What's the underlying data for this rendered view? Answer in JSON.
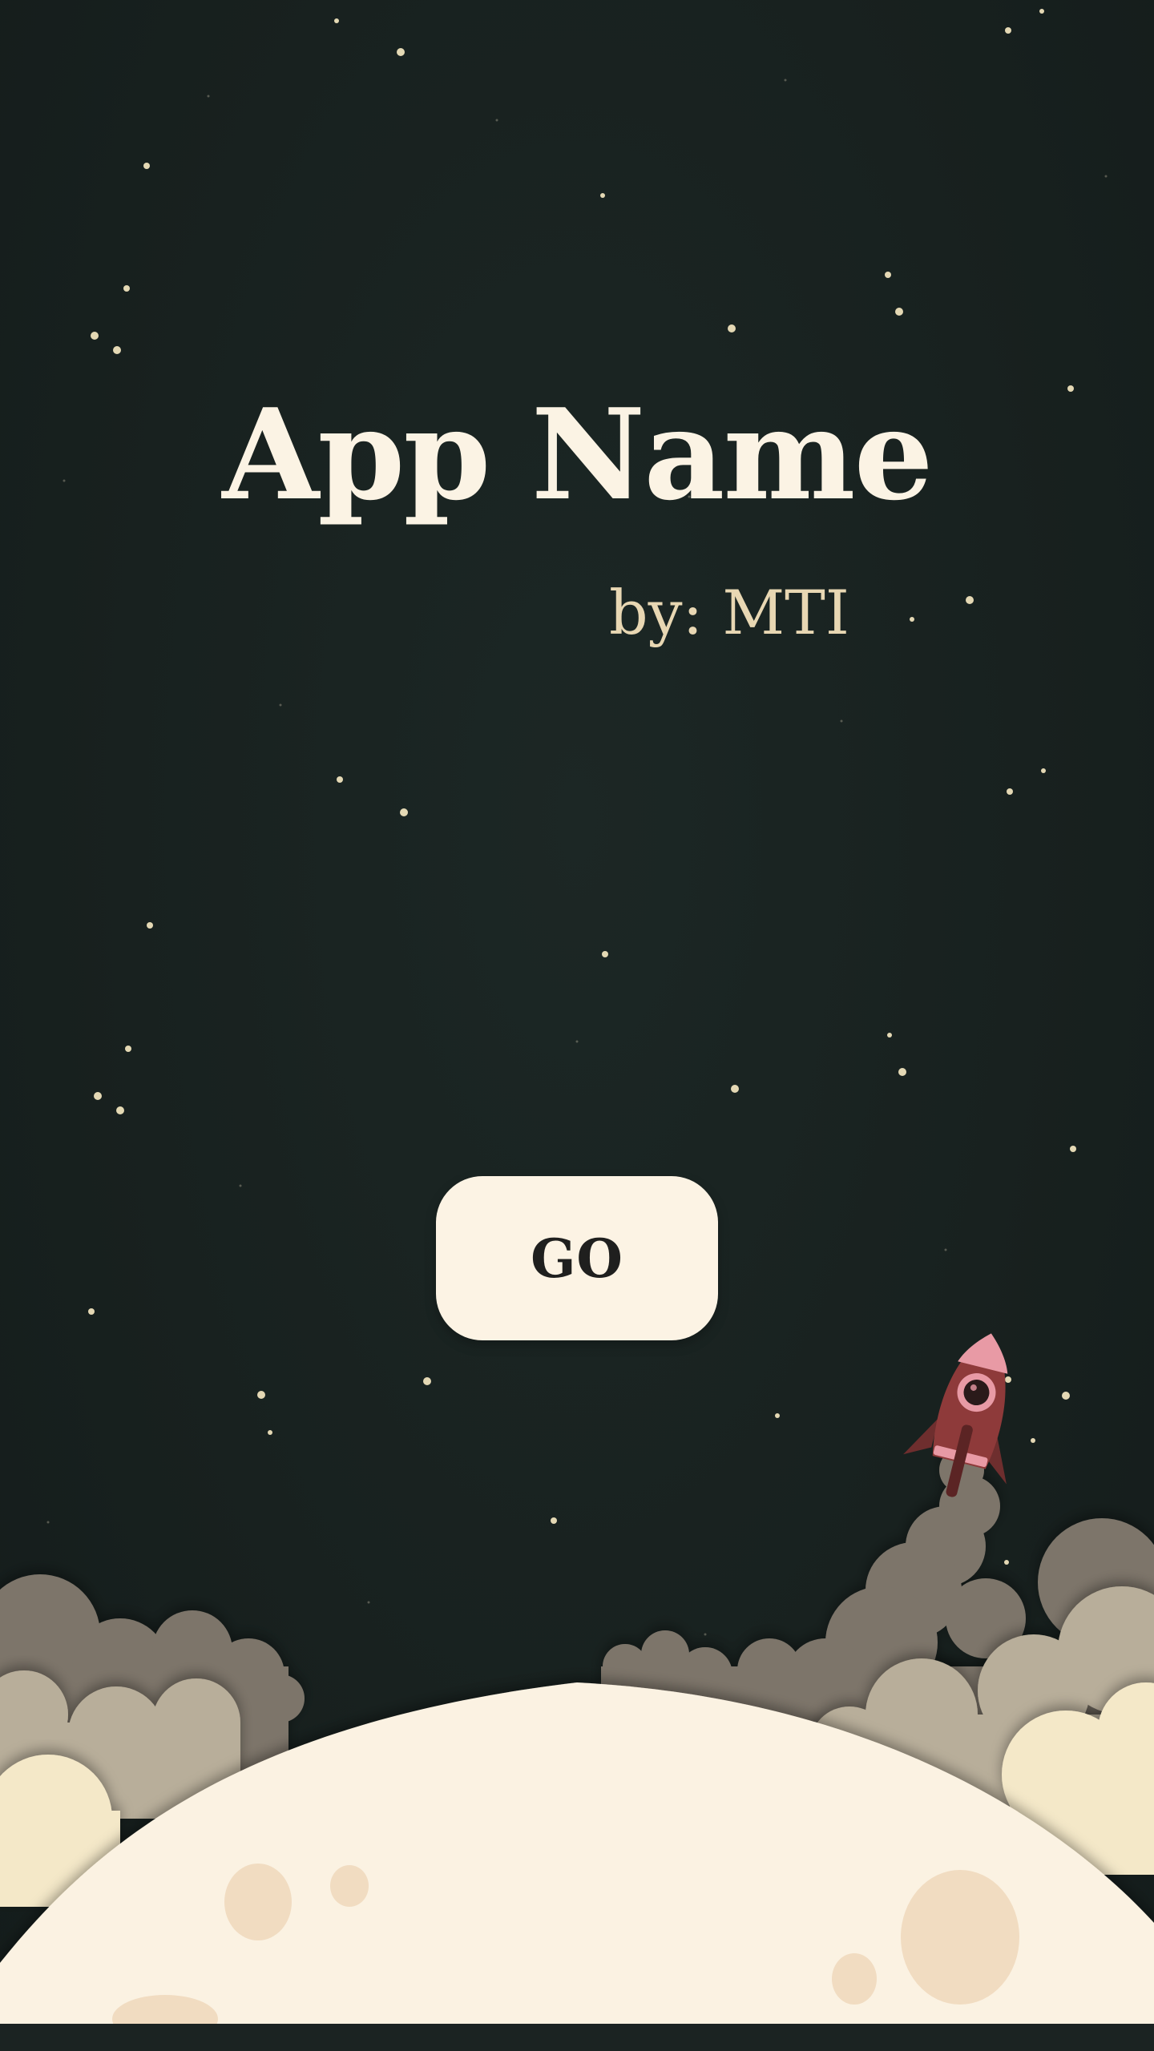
{
  "app": {
    "title": "App Name",
    "byline": "by: MTI"
  },
  "actions": {
    "go_label": "GO"
  },
  "illustration": {
    "icons": [
      "rocket-icon",
      "moon-surface",
      "smoke-clouds",
      "stars"
    ]
  },
  "colors": {
    "background": "#18211f",
    "title": "#fbf3e4",
    "byline": "#e8d7b3",
    "button_bg": "#fcf3e4",
    "button_text": "#1f1f1e",
    "moon": "#fbf2e2",
    "crater": "#f1dcc1",
    "smoke_dark": "#7d756b",
    "smoke_mid": "#b8ae9a",
    "smoke_light": "#f4e8c8",
    "rocket_body": "#8e3a3a",
    "rocket_tip": "#e89aa5"
  }
}
